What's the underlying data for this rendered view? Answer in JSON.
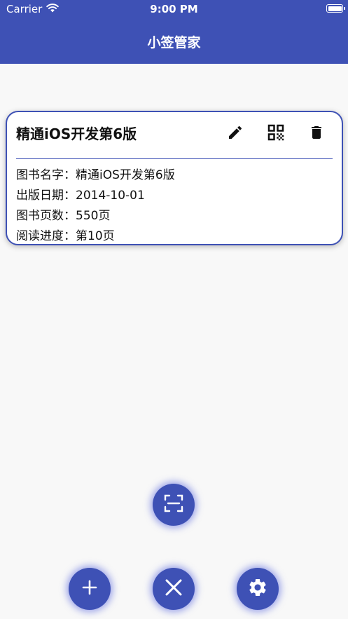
{
  "status_bar": {
    "carrier": "Carrier",
    "time": "9:00 PM"
  },
  "header": {
    "title": "小签管家"
  },
  "book_card": {
    "title": "精通iOS开发第6版",
    "actions": [
      "edit-icon",
      "qr-code-icon",
      "delete-icon"
    ],
    "rows": [
      {
        "label": "图书名字：",
        "value": "精通iOS开发第6版"
      },
      {
        "label": "出版日期：",
        "value": "2014-10-01"
      },
      {
        "label": "图书页数：",
        "value": "550页"
      },
      {
        "label": "阅读进度：",
        "value": "第10页"
      }
    ]
  },
  "fab_buttons": [
    "scan-icon",
    "add-icon",
    "close-icon",
    "settings-icon"
  ],
  "colors": {
    "primary": "#3e51b5",
    "background": "#f8f8f8",
    "card": "#ffffff"
  }
}
